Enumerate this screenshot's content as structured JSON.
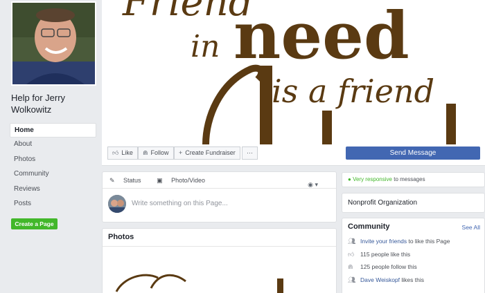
{
  "page": {
    "name": "Help for Jerry Wolkowitz"
  },
  "left_nav": {
    "items": [
      "Home",
      "About",
      "Photos",
      "Community",
      "Reviews",
      "Posts"
    ],
    "create_page": "Create a Page"
  },
  "cover": {
    "line1": "Friend",
    "line2a": "in",
    "line2b": "need",
    "line3": "is a friend"
  },
  "actions": {
    "like": "Like",
    "follow": "Follow",
    "fundraiser": "Create Fundraiser",
    "more": "···",
    "send_message": "Send Message"
  },
  "composer": {
    "status": "Status",
    "photo_video": "Photo/Video",
    "placeholder": "Write something on this Page..."
  },
  "photos": {
    "title": "Photos"
  },
  "sidebar": {
    "responsive_highlight": "Very responsive",
    "responsive_rest": "to messages",
    "category": "Nonprofit Organization",
    "community": {
      "title": "Community",
      "see_all": "See All",
      "invite_link": "Invite your friends",
      "invite_rest": "to like this Page",
      "likes": "115 people like this",
      "follows": "125 people follow this",
      "friend_name": "Dave Weiskopf",
      "friend_rest": "likes this"
    }
  },
  "colors": {
    "accent": "#4267b2",
    "green": "#42b72a",
    "cover_text": "#5a3a12"
  }
}
